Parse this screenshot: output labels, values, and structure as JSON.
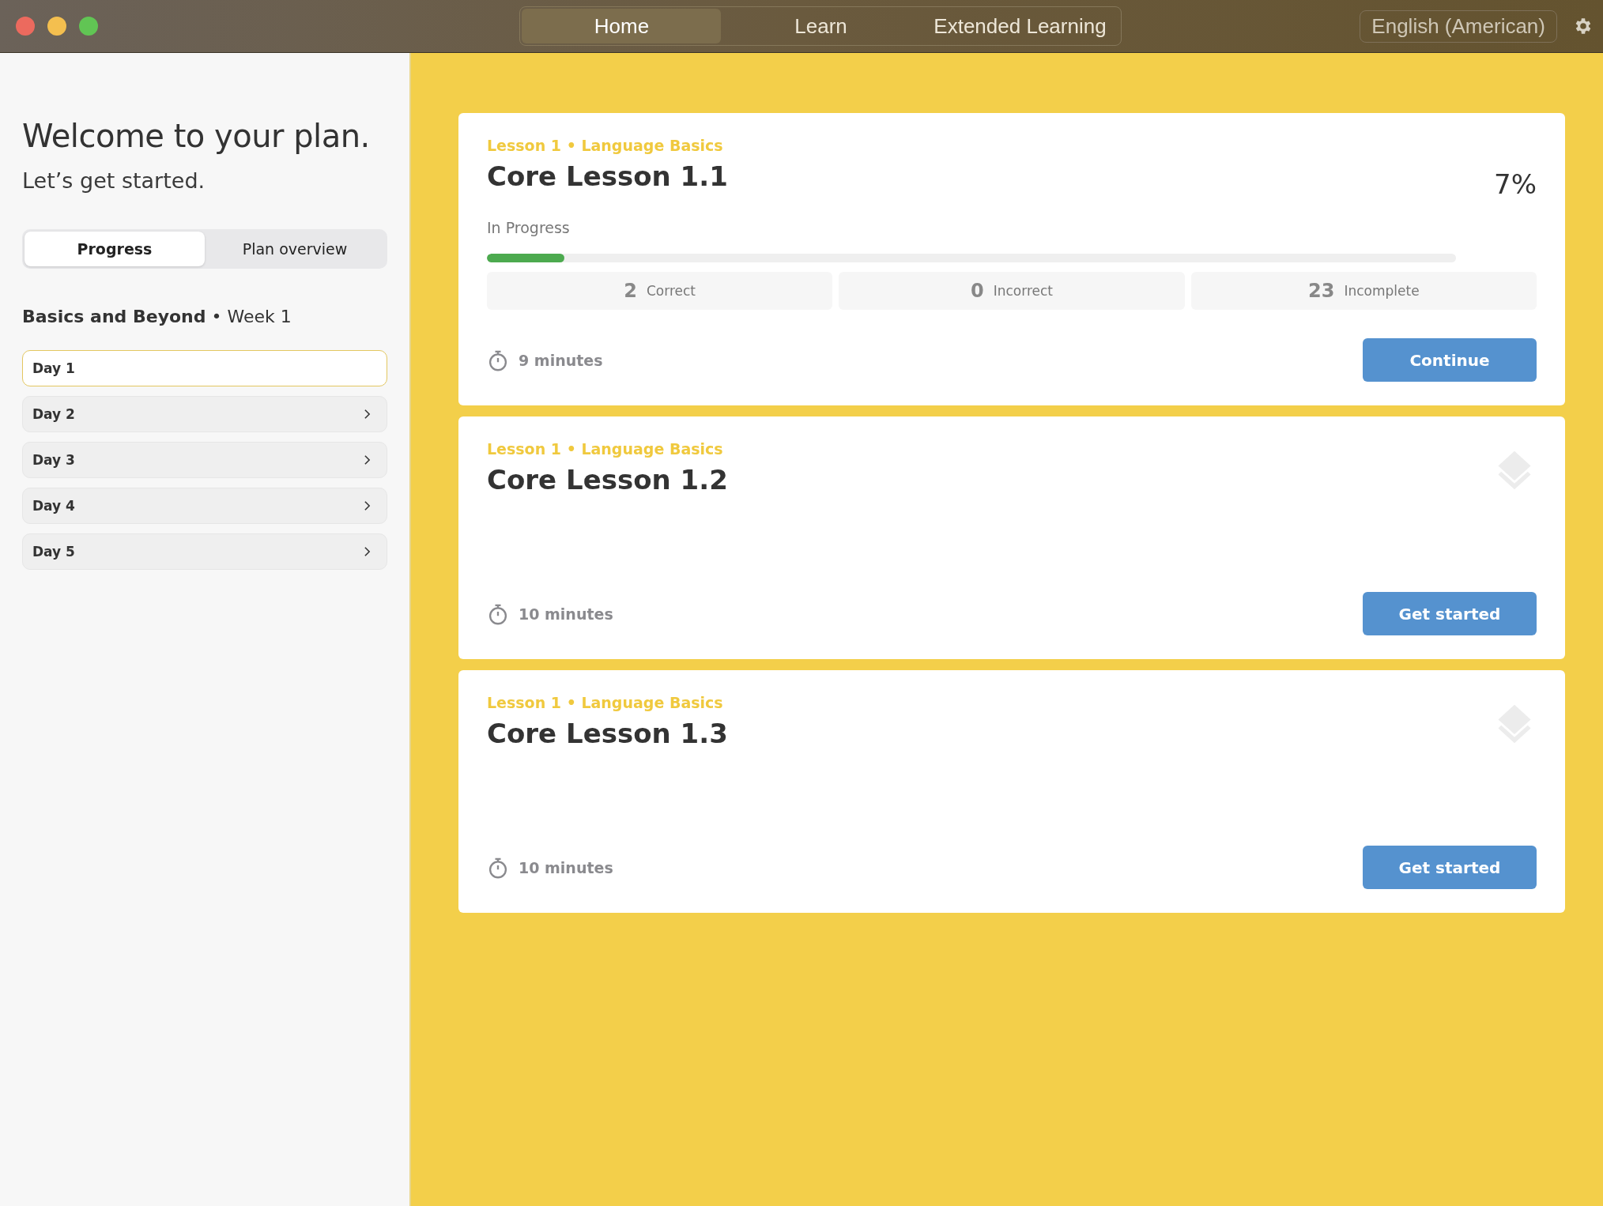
{
  "window": {
    "nav_tabs": [
      {
        "label": "Home",
        "selected": true
      },
      {
        "label": "Learn",
        "selected": false
      },
      {
        "label": "Extended Learning",
        "selected": false
      }
    ],
    "language": "English (American)"
  },
  "sidebar": {
    "title": "Welcome to your plan.",
    "subtitle": "Let’s get started.",
    "segments": [
      {
        "label": "Progress",
        "selected": true
      },
      {
        "label": "Plan overview",
        "selected": false
      }
    ],
    "plan_heading": "**Basics and Beyond** • Week 1",
    "days": [
      {
        "label": "Day 1",
        "selected": true
      },
      {
        "label": "Day 2",
        "selected": false
      },
      {
        "label": "Day 3",
        "selected": false
      },
      {
        "label": "Day 4",
        "selected": false
      },
      {
        "label": "Day 5",
        "selected": false
      }
    ]
  },
  "lessons": [
    {
      "kind": "progress",
      "kicker": "Lesson 1 • Language Basics",
      "title": "Core Lesson 1.1",
      "percent": "7%",
      "status": "In Progress",
      "level": 0.08,
      "stats": [
        {
          "count": "2",
          "label": "Correct"
        },
        {
          "count": "0",
          "label": "Incorrect"
        },
        {
          "count": "23",
          "label": "Incomplete"
        }
      ],
      "duration": "9 minutes",
      "button": "Continue"
    },
    {
      "kind": "new",
      "kicker": "Lesson 1 • Language Basics",
      "title": "Core Lesson 1.2",
      "duration": "10 minutes",
      "button": "Get started"
    },
    {
      "kind": "new",
      "kicker": "Lesson 1 • Language Basics",
      "title": "Core Lesson 1.3",
      "duration": "10 minutes",
      "button": "Get started"
    }
  ]
}
